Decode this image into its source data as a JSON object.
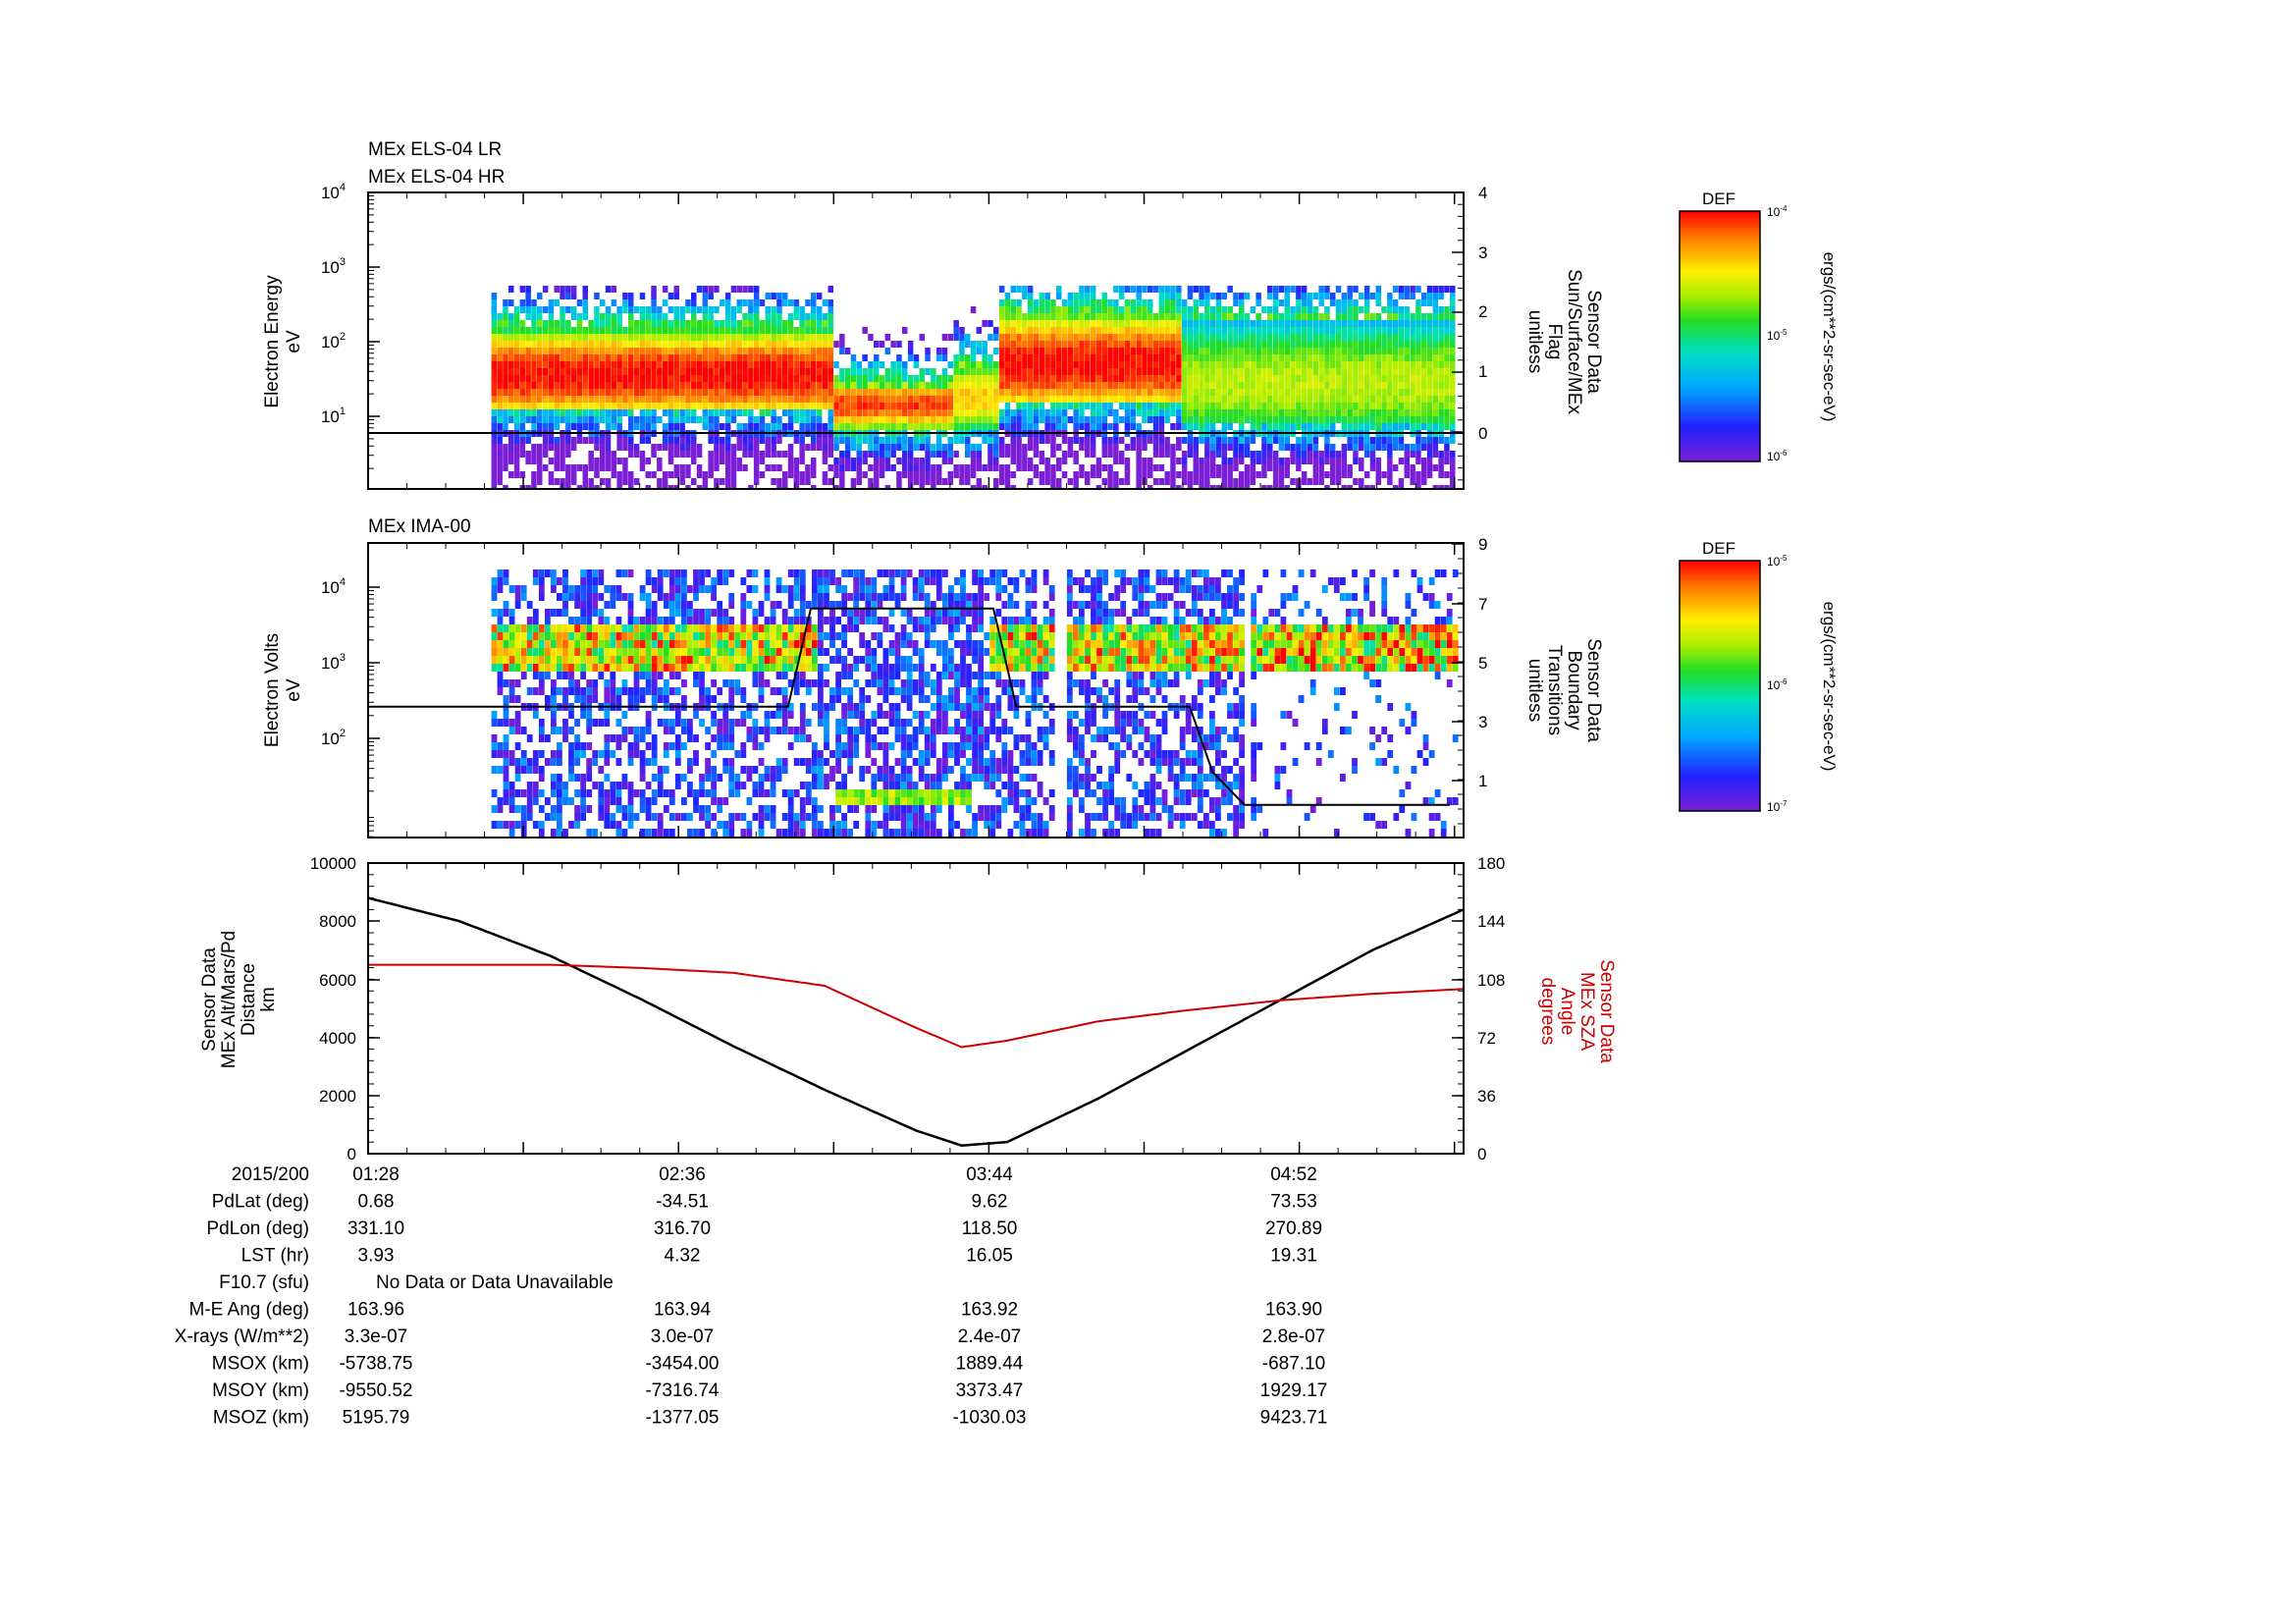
{
  "panels": {
    "els": {
      "titles": [
        "MEx ELS-04 LR",
        "MEx ELS-04 HR"
      ],
      "ylabel": [
        "Electron Energy",
        "eV"
      ],
      "yticks": [
        "10^4",
        "10^3",
        "10^2",
        "10^1"
      ],
      "right_label": [
        "Sensor Data",
        "Sun/Surface/MEx",
        "Flag",
        "unitless"
      ],
      "right_ticks": [
        "4",
        "3",
        "2",
        "1",
        "0"
      ],
      "colorbar": {
        "title": "DEF",
        "ticks": [
          "10^-4",
          "10^-5",
          "10^-6"
        ],
        "unit": "ergs/(cm**2-sr-sec-eV)"
      }
    },
    "ima": {
      "title": "MEx IMA-00",
      "ylabel": [
        "Electron Volts",
        "eV"
      ],
      "yticks": [
        "10^4",
        "10^3",
        "10^2"
      ],
      "right_label": [
        "Sensor Data",
        "Boundary",
        "Transitions",
        "unitless"
      ],
      "right_ticks": [
        "9",
        "7",
        "5",
        "3",
        "1"
      ],
      "colorbar": {
        "title": "DEF",
        "ticks": [
          "10^-5",
          "10^-6",
          "10^-7"
        ],
        "unit": "ergs/(cm**2-sr-sec-eV)"
      }
    },
    "alt": {
      "ylabel": [
        "Sensor Data",
        "MEx Alt/Mars/Pd",
        "Distance",
        "km"
      ],
      "yticks": [
        "10000",
        "8000",
        "6000",
        "4000",
        "2000",
        "0"
      ],
      "right_label": [
        "Sensor Data",
        "MEx SZA",
        "Angle",
        "degrees"
      ],
      "right_ticks": [
        "180",
        "144",
        "108",
        "72",
        "36",
        "0"
      ],
      "line_colors": {
        "alt": "#000000",
        "sza": "#cc0000"
      }
    }
  },
  "chart_data": [
    {
      "type": "heatmap",
      "title": "MEx ELS-04 LR / MEx ELS-04 HR",
      "ylabel": "Electron Energy (eV)",
      "yscale": "log",
      "ylim": [
        1,
        10000
      ],
      "y2label": "Sensor Data Sun/Surface/MEx Flag (unitless)",
      "y2lim": [
        -1,
        4
      ],
      "colorbar": {
        "label": "DEF",
        "unit": "ergs/(cm**2-sr-sec-eV)",
        "range": [
          "1e-6",
          "1e-4"
        ],
        "scale": "log"
      },
      "x": [
        "01:28",
        "02:36",
        "03:44",
        "04:52"
      ],
      "description_of_regions": [
        {
          "time_range": [
            "01:55",
            "03:10"
          ],
          "energy_eV_core": [
            15,
            150
          ],
          "level": "high"
        },
        {
          "time_range": [
            "03:10",
            "03:35"
          ],
          "energy_eV_core": [
            8,
            30
          ],
          "level": "high"
        },
        {
          "time_range": [
            "03:44",
            "04:25"
          ],
          "energy_eV_core": [
            20,
            250
          ],
          "level": "high"
        },
        {
          "time_range": [
            "04:25",
            "05:25"
          ],
          "energy_eV_core": [
            10,
            200
          ],
          "level": "medium"
        }
      ],
      "flag_series": {
        "x": [
          "01:28",
          "05:25"
        ],
        "values": [
          0,
          0
        ]
      }
    },
    {
      "type": "heatmap",
      "title": "MEx IMA-00",
      "ylabel": "Electron Volts (eV)",
      "yscale": "log",
      "ylim": [
        10,
        30000
      ],
      "y2label": "Sensor Data Boundary Transitions (unitless)",
      "y2lim": [
        0,
        9
      ],
      "colorbar": {
        "label": "DEF",
        "unit": "ergs/(cm**2-sr-sec-eV)",
        "range": [
          "1e-7",
          "1e-5"
        ],
        "scale": "log"
      },
      "x": [
        "01:28",
        "02:36",
        "03:44",
        "04:52"
      ],
      "boundary_series": {
        "x": [
          "01:28",
          "02:45",
          "03:00",
          "03:05",
          "03:45",
          "03:50",
          "04:28",
          "04:33",
          "04:40",
          "05:25"
        ],
        "values": [
          4,
          4,
          4,
          7,
          7,
          4,
          4,
          2,
          1,
          1
        ]
      }
    },
    {
      "type": "line",
      "xlabel": "",
      "ylabel": "Sensor Data MEx Alt/Mars/Pd Distance (km)",
      "ylim": [
        0,
        10000
      ],
      "y2label": "Sensor Data MEx SZA Angle (degrees)",
      "y2lim": [
        0,
        180
      ],
      "x_minutes_after_01_28": [
        0,
        20,
        40,
        60,
        80,
        100,
        120,
        130,
        140,
        160,
        180,
        200,
        220,
        240
      ],
      "series": [
        {
          "name": "MEx Alt/Mars/Pd Distance",
          "axis": "left",
          "values": [
            8800,
            8000,
            6800,
            5300,
            3700,
            2200,
            800,
            280,
            400,
            1900,
            3600,
            5300,
            7000,
            8400
          ]
        },
        {
          "name": "MEx SZA Angle",
          "axis": "right",
          "values": [
            117,
            117,
            117,
            115,
            112,
            104,
            78,
            66,
            70,
            82,
            89,
            95,
            99,
            102
          ]
        }
      ]
    }
  ],
  "ephemeris": {
    "rows": [
      {
        "label": "2015/200",
        "values": [
          "01:28",
          "02:36",
          "03:44",
          "04:52"
        ]
      },
      {
        "label": "PdLat (deg)",
        "values": [
          "0.68",
          "-34.51",
          "9.62",
          "73.53"
        ]
      },
      {
        "label": "PdLon (deg)",
        "values": [
          "331.10",
          "316.70",
          "118.50",
          "270.89"
        ]
      },
      {
        "label": "LST (hr)",
        "values": [
          "3.93",
          "4.32",
          "16.05",
          "19.31"
        ]
      },
      {
        "label": "F10.7 (sfu)",
        "values": [
          "No Data or Data Unavailable"
        ]
      },
      {
        "label": "M-E Ang (deg)",
        "values": [
          "163.96",
          "163.94",
          "163.92",
          "163.90"
        ]
      },
      {
        "label": "X-rays (W/m**2)",
        "values": [
          "3.3e-07",
          "3.0e-07",
          "2.4e-07",
          "2.8e-07"
        ]
      },
      {
        "label": "MSOX (km)",
        "values": [
          "-5738.75",
          "-3454.00",
          "1889.44",
          "-687.10"
        ]
      },
      {
        "label": "MSOY (km)",
        "values": [
          "-9550.52",
          "-7316.74",
          "3373.47",
          "1929.17"
        ]
      },
      {
        "label": "MSOZ (km)",
        "values": [
          "5195.79",
          "-1377.05",
          "-1030.03",
          "9423.71"
        ]
      }
    ]
  }
}
